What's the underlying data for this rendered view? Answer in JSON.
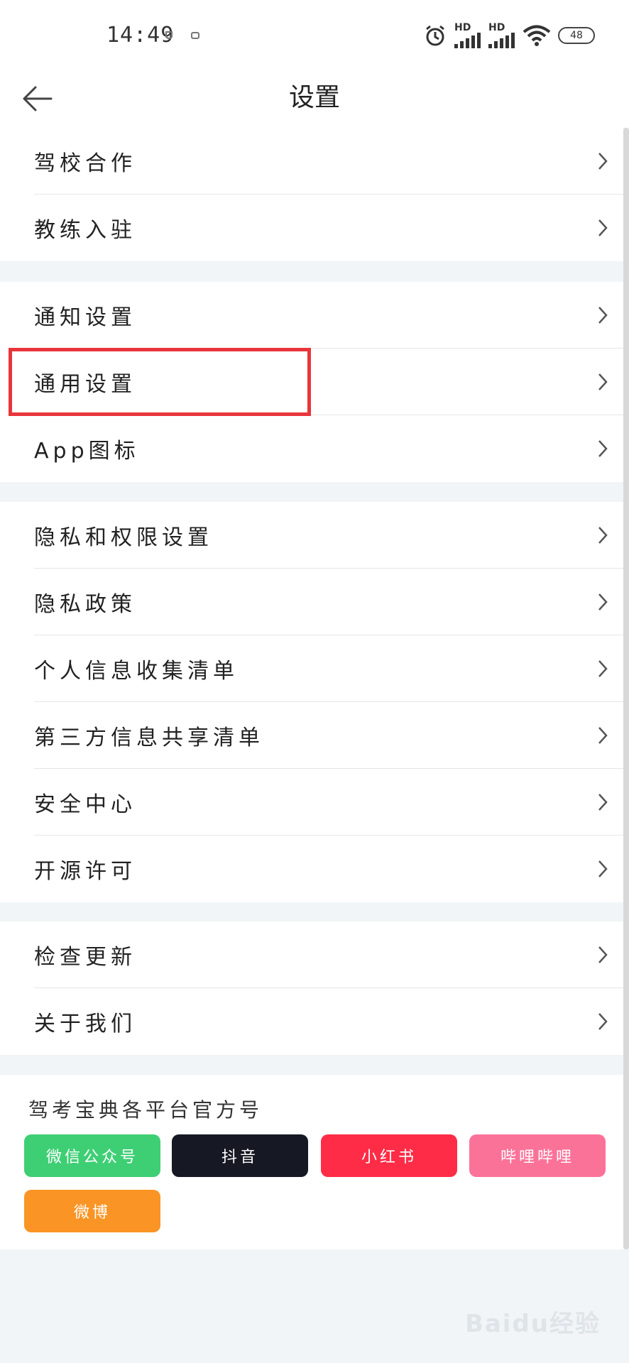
{
  "status_bar": {
    "time": "14:49",
    "hd_label": "HD",
    "battery": "48"
  },
  "header": {
    "title": "设置"
  },
  "groups": [
    [
      {
        "label": "驾校合作"
      },
      {
        "label": "教练入驻"
      }
    ],
    [
      {
        "label": "通知设置"
      },
      {
        "label": "通用设置"
      },
      {
        "label": "App图标"
      }
    ],
    [
      {
        "label": "隐私和权限设置"
      },
      {
        "label": "隐私政策"
      },
      {
        "label": "个人信息收集清单"
      },
      {
        "label": "第三方信息共享清单"
      },
      {
        "label": "安全中心"
      },
      {
        "label": "开源许可"
      }
    ],
    [
      {
        "label": "检查更新"
      },
      {
        "label": "关于我们"
      }
    ]
  ],
  "platforms": {
    "title": "驾考宝典各平台官方号",
    "buttons": [
      {
        "label": "微信公众号",
        "color": "#3ecf74"
      },
      {
        "label": "抖音",
        "color": "#161823"
      },
      {
        "label": "小红书",
        "color": "#fe2c46"
      },
      {
        "label": "哔哩哔哩",
        "color": "#fb7299"
      },
      {
        "label": "微博",
        "color": "#fa9424"
      }
    ]
  },
  "watermark": "Baidu经验",
  "colors": {
    "highlight": "#e8353b",
    "background": "#f1f5f7"
  }
}
